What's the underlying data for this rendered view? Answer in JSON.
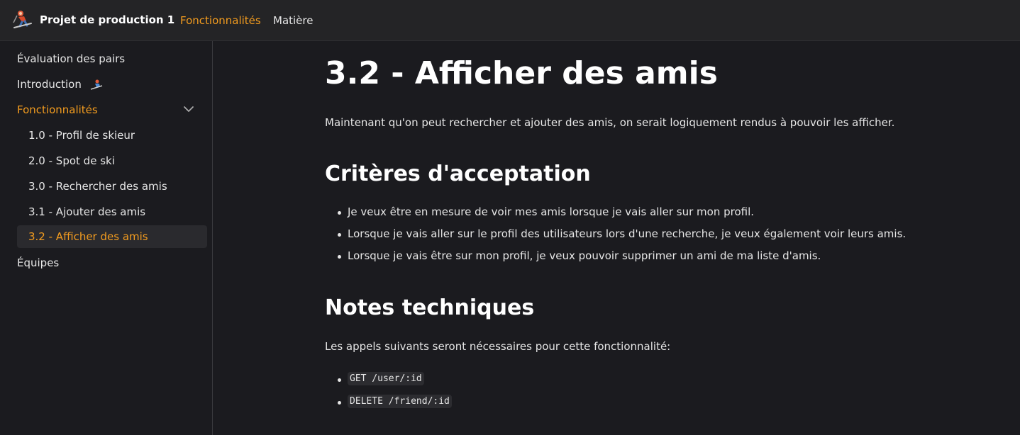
{
  "header": {
    "brand": "Projet de production 1",
    "nav": [
      {
        "label": "Fonctionnalités",
        "active": true
      },
      {
        "label": "Matière",
        "active": false
      }
    ]
  },
  "sidebar": {
    "items": [
      {
        "label": "Évaluation des pairs"
      },
      {
        "label": "Introduction"
      },
      {
        "label": "Fonctionnalités"
      },
      {
        "label": "1.0 - Profil de skieur"
      },
      {
        "label": "2.0 - Spot de ski"
      },
      {
        "label": "3.0 - Rechercher des amis"
      },
      {
        "label": "3.1 - Ajouter des amis"
      },
      {
        "label": "3.2 - Afficher des amis"
      },
      {
        "label": "Équipes"
      }
    ]
  },
  "main": {
    "title": "3.2 - Afficher des amis",
    "intro": "Maintenant qu'on peut rechercher et ajouter des amis, on serait logiquement rendus à pouvoir les afficher.",
    "criteria_heading": "Critères d'acceptation",
    "criteria": [
      "Je veux être en mesure de voir mes amis lorsque je vais aller sur mon profil.",
      "Lorsque je vais aller sur le profil des utilisateurs lors d'une recherche, je veux également voir leurs amis.",
      "Lorsque je vais être sur mon profil, je veux pouvoir supprimer un ami de ma liste d'amis."
    ],
    "notes_heading": "Notes techniques",
    "notes_intro": "Les appels suivants seront nécessaires pour cette fonctionnalité:",
    "calls": [
      "GET /user/:id",
      "DELETE /friend/:id"
    ]
  },
  "colors": {
    "accent": "#f39c1f",
    "background": "#1b1b1f",
    "topbar": "#242426"
  }
}
